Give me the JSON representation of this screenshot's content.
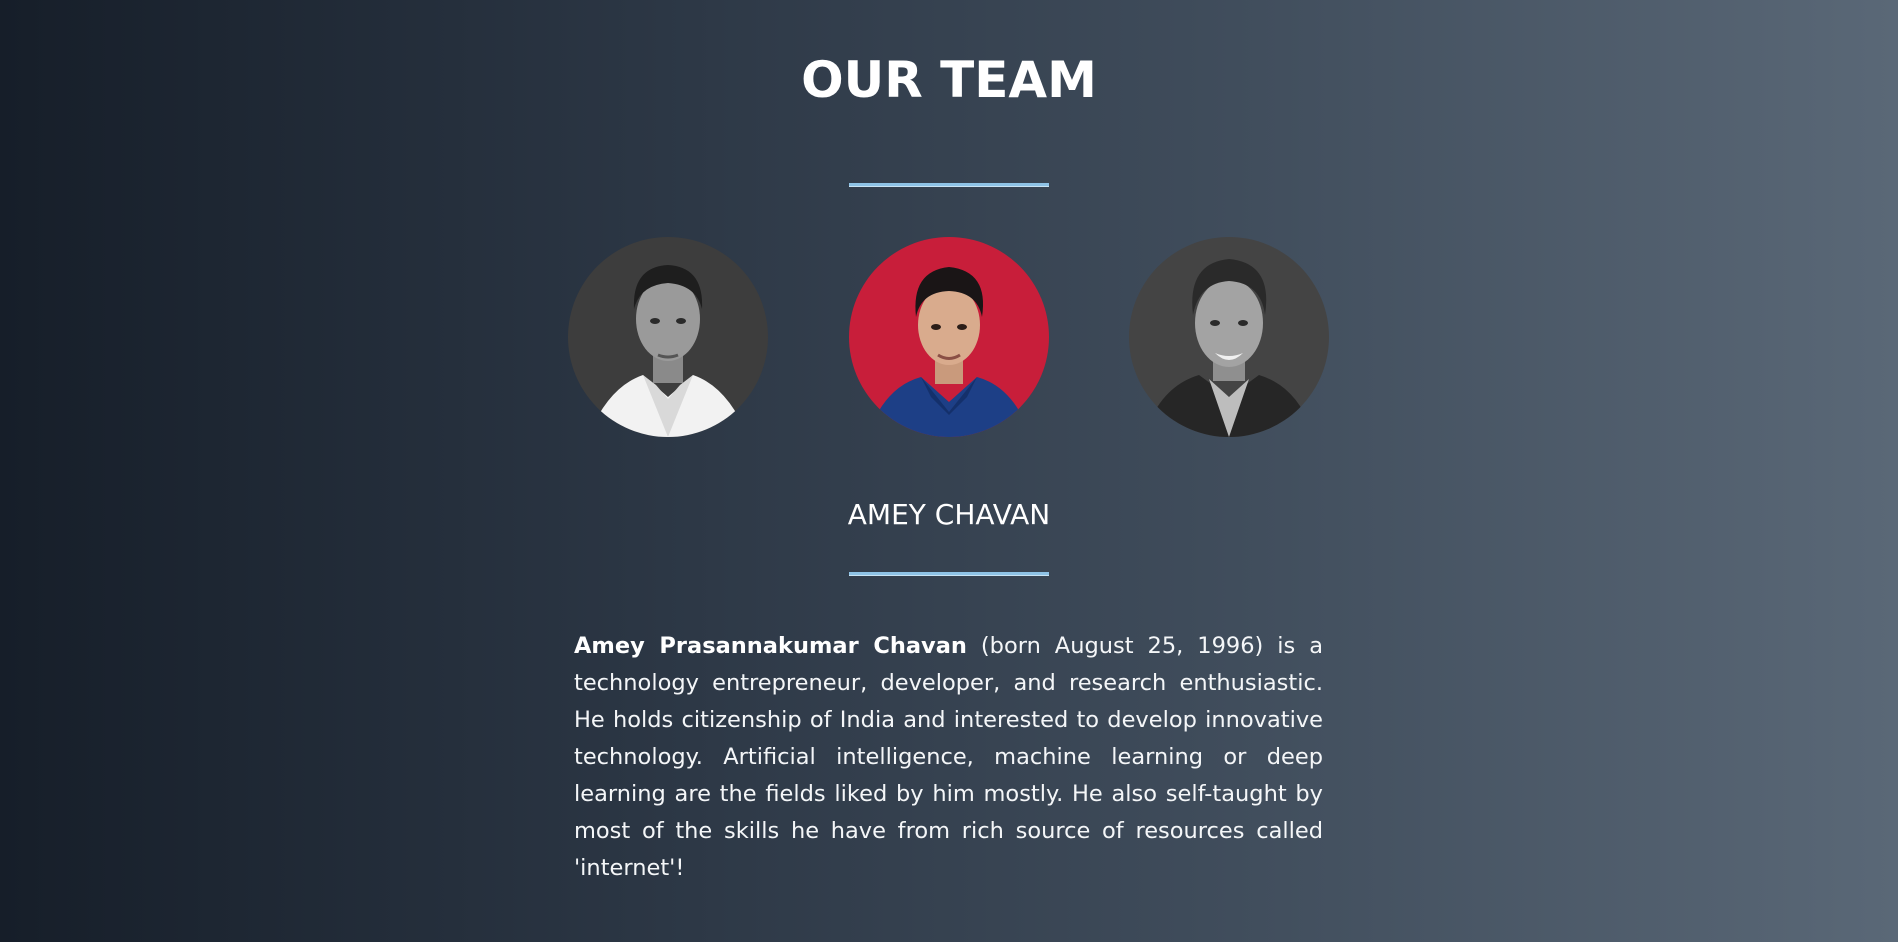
{
  "header": {
    "title": "OUR TEAM"
  },
  "team": {
    "members": [
      {
        "name": "",
        "photo_style": "grayscale"
      },
      {
        "name": "AMEY CHAVAN",
        "photo_style": "color-red-background"
      },
      {
        "name": "",
        "photo_style": "grayscale"
      }
    ],
    "selected_index": 1
  },
  "selected_member": {
    "display_name": "AMEY CHAVAN",
    "bio_name": "Amey Prasannakumar Chavan",
    "bio_text": " (born August 25, 1996) is a technology entrepreneur, developer, and research enthusiastic. He holds citizenship of India and interested to develop innovative technology. Artificial intelligence, machine learning or deep learning are the fields liked by him mostly. He also self-taught by most of the skills he have from rich source of resources called 'internet'!"
  },
  "colors": {
    "divider": "#8ec3e6",
    "background_start": "#161e29",
    "background_end": "#5a6877",
    "avatar_red_bg": "#c81e3a"
  }
}
